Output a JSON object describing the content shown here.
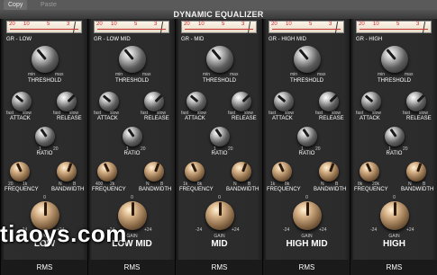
{
  "menu": {
    "copy": "Copy",
    "paste": "Paste"
  },
  "title": "DYNAMIC EQUALIZER",
  "watermark": "tiaoys.com",
  "meter_scale": [
    "20",
    "10",
    "5",
    "3"
  ],
  "labels": {
    "threshold": "THRESHOLD",
    "min": "min",
    "max": "max",
    "attack": "ATTACK",
    "release": "RELEASE",
    "fast": "fast",
    "slow": "slow",
    "ratio": "RATIO",
    "ratio_min": "1",
    "ratio_max": "20",
    "frequency": "FREQUENCY",
    "bandwidth": "BANDWIDTH",
    "n": "N",
    "b": "B",
    "gain": "GAIN",
    "gain_zero": "0",
    "gain_min": "-24",
    "gain_max": "+24",
    "rms": "RMS"
  },
  "bands": [
    {
      "gr_label": "GR - LOW",
      "name": "LOW",
      "freq_min": "20",
      "freq_max": "1k"
    },
    {
      "gr_label": "GR - LOW MID",
      "name": "LOW MID",
      "freq_min": "400",
      "freq_max": "2k"
    },
    {
      "gr_label": "GR - MID",
      "name": "MID",
      "freq_min": "1k",
      "freq_max": "8k"
    },
    {
      "gr_label": "GR - HIGH MID",
      "name": "HIGH MID",
      "freq_min": "1k",
      "freq_max": "8k"
    },
    {
      "gr_label": "GR - HIGH",
      "name": "HIGH",
      "freq_min": "8k",
      "freq_max": "20k"
    }
  ]
}
